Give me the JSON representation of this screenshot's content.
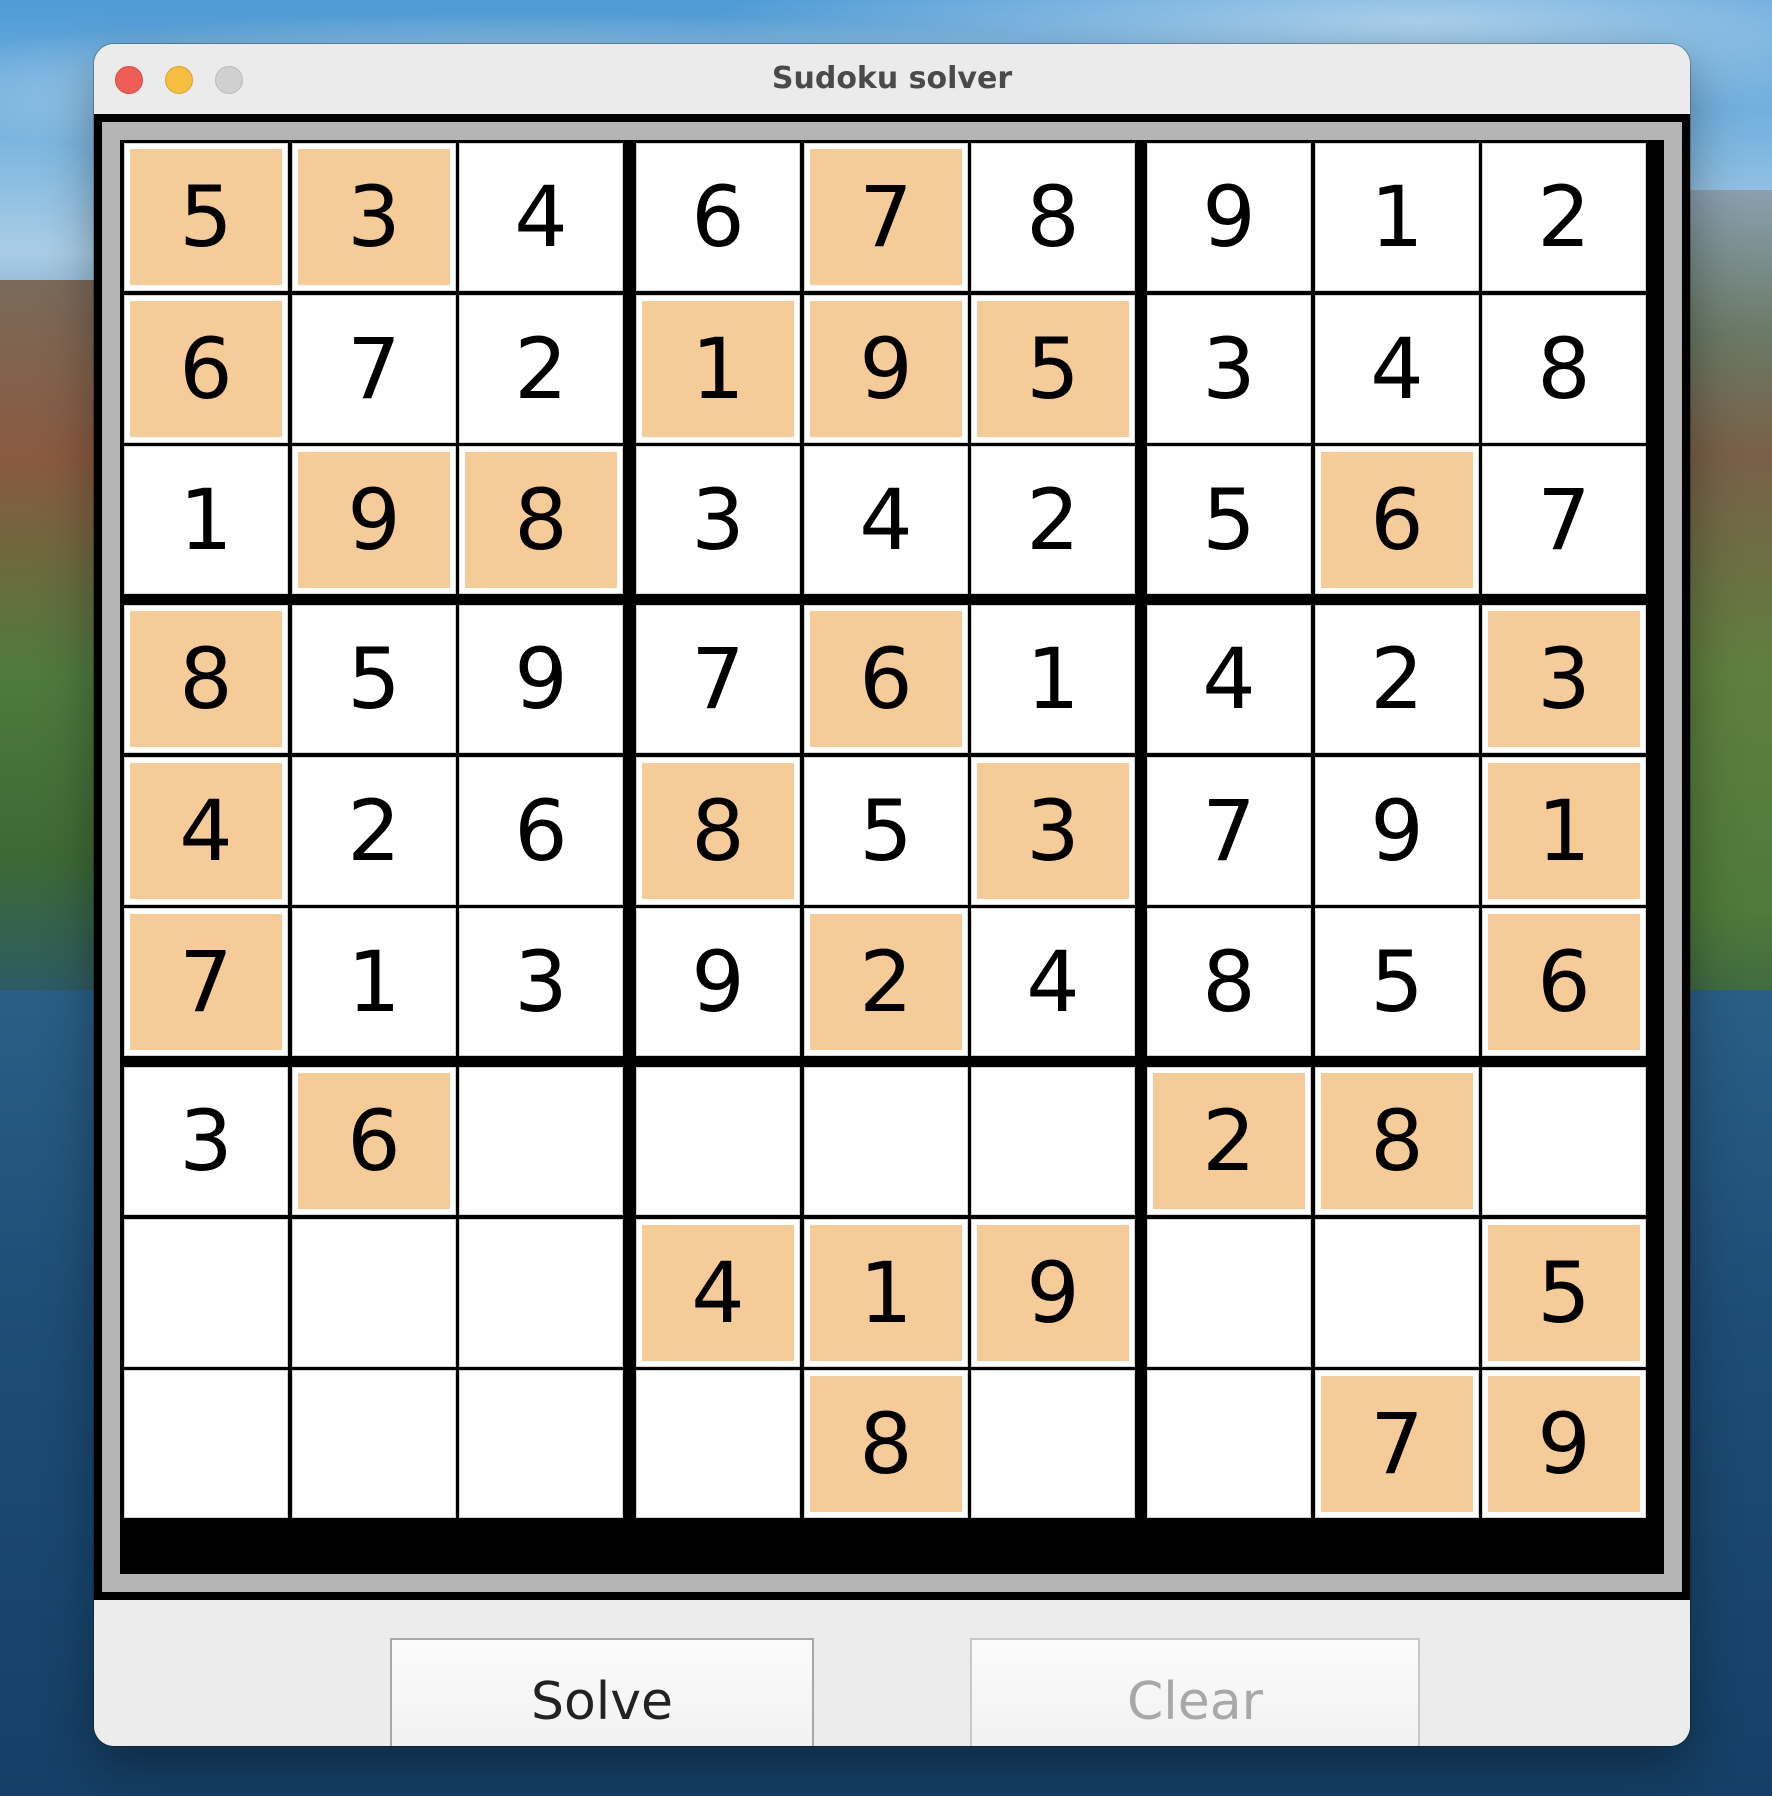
{
  "window": {
    "title": "Sudoku solver"
  },
  "board": {
    "cells": [
      [
        "5",
        "3",
        "4",
        "6",
        "7",
        "8",
        "9",
        "1",
        "2"
      ],
      [
        "6",
        "7",
        "2",
        "1",
        "9",
        "5",
        "3",
        "4",
        "8"
      ],
      [
        "1",
        "9",
        "8",
        "3",
        "4",
        "2",
        "5",
        "6",
        "7"
      ],
      [
        "8",
        "5",
        "9",
        "7",
        "6",
        "1",
        "4",
        "2",
        "3"
      ],
      [
        "4",
        "2",
        "6",
        "8",
        "5",
        "3",
        "7",
        "9",
        "1"
      ],
      [
        "7",
        "1",
        "3",
        "9",
        "2",
        "4",
        "8",
        "5",
        "6"
      ],
      [
        "3",
        "6",
        "",
        "",
        "",
        "",
        "2",
        "8",
        ""
      ],
      [
        "",
        "",
        "",
        "4",
        "1",
        "9",
        "",
        "",
        "5"
      ],
      [
        "",
        "",
        "",
        "",
        "8",
        "",
        "",
        "7",
        "9"
      ]
    ],
    "given": [
      [
        1,
        1,
        0,
        0,
        1,
        0,
        0,
        0,
        0
      ],
      [
        1,
        0,
        0,
        1,
        1,
        1,
        0,
        0,
        0
      ],
      [
        0,
        1,
        1,
        0,
        0,
        0,
        0,
        1,
        0
      ],
      [
        1,
        0,
        0,
        0,
        1,
        0,
        0,
        0,
        1
      ],
      [
        1,
        0,
        0,
        1,
        0,
        1,
        0,
        0,
        1
      ],
      [
        1,
        0,
        0,
        0,
        1,
        0,
        0,
        0,
        1
      ],
      [
        0,
        1,
        0,
        0,
        0,
        0,
        1,
        1,
        0
      ],
      [
        0,
        0,
        0,
        1,
        1,
        1,
        0,
        0,
        1
      ],
      [
        0,
        0,
        0,
        0,
        1,
        0,
        0,
        1,
        1
      ]
    ],
    "given_color": "#f5cb98"
  },
  "buttons": {
    "solve_label": "Solve",
    "clear_label": "Clear"
  },
  "colors": {
    "close": "#ee5e57",
    "minimize": "#f5be3f",
    "zoom": "#d0d0d0"
  }
}
